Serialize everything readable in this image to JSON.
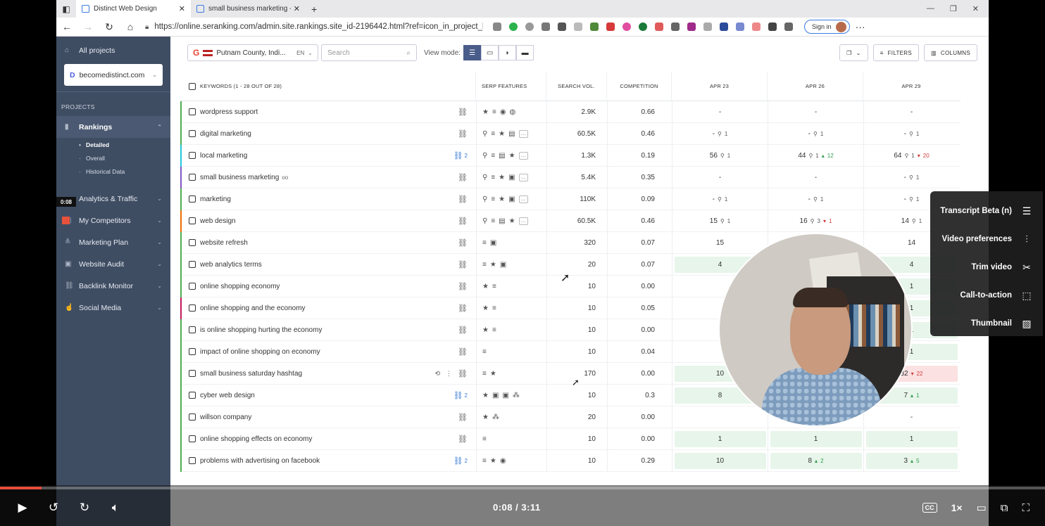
{
  "browser": {
    "tabs": [
      {
        "title": "Distinct Web Design"
      },
      {
        "title": "small business marketing - Apr..."
      }
    ],
    "url": "https://online.seranking.com/admin.site.rankings.site_id-2196442.html?ref=icon_in_project_list_...",
    "signin": "Sign in"
  },
  "sidebar": {
    "all_projects": "All projects",
    "project": "becomedistinct.com",
    "projects_head": "PROJECTS",
    "rankings": "Rankings",
    "sub": [
      "Detailed",
      "Overall",
      "Historical Data"
    ],
    "items": [
      "Analytics & Traffic",
      "My Competitors",
      "Marketing Plan",
      "Website Audit",
      "Backlink Monitor",
      "Social Media"
    ]
  },
  "toolbar": {
    "location": "Putnam County, Indi...",
    "lang": "EN",
    "search_placeholder": "Search",
    "view_mode": "View mode:",
    "filters": "FILTERS",
    "columns": "COLUMNS"
  },
  "table": {
    "headers": {
      "keywords": "KEYWORDS (1 - 28 OUT OF 28)",
      "serp": "SERP FEATURES",
      "vol": "SEARCH VOL.",
      "comp": "COMPETITION",
      "d1": "APR 23",
      "d2": "APR 26",
      "d3": "APR 29"
    },
    "rows": [
      {
        "kw": "wordpress support",
        "vol": "2.9K",
        "comp": "0.66",
        "d1": "-",
        "d2": "-",
        "d3": "-"
      },
      {
        "kw": "digital marketing",
        "vol": "60.5K",
        "comp": "0.46",
        "d1": "-",
        "d1p": "1",
        "d2": "-",
        "d2p": "1",
        "d3": "-",
        "d3p": "1"
      },
      {
        "kw": "local marketing",
        "links": "2",
        "vol": "1.3K",
        "comp": "0.19",
        "d1": "56",
        "d1p": "1",
        "d2": "44",
        "d2p": "1",
        "d2c": "12",
        "d3": "64",
        "d3p": "1",
        "d3c": "20"
      },
      {
        "kw": "small business marketing",
        "tag": "oo",
        "vol": "5.4K",
        "comp": "0.35",
        "d1": "-",
        "d2": "-",
        "d3": "-",
        "d3p": "1"
      },
      {
        "kw": "marketing",
        "vol": "110K",
        "comp": "0.09",
        "d1": "-",
        "d1p": "1",
        "d2": "-",
        "d2p": "1",
        "d3": "-",
        "d3p": "1"
      },
      {
        "kw": "web design",
        "vol": "60.5K",
        "comp": "0.46",
        "d1": "15",
        "d1p": "1",
        "d2": "16",
        "d2p": "3",
        "d2c": "1",
        "d3": "14",
        "d3p": "1"
      },
      {
        "kw": "website refresh",
        "vol": "320",
        "comp": "0.07",
        "d1": "15",
        "d2": "",
        "d3": "14"
      },
      {
        "kw": "web analytics terms",
        "vol": "20",
        "comp": "0.07",
        "d1": "4",
        "d2": "",
        "d3": "4"
      },
      {
        "kw": "online shopping economy",
        "vol": "10",
        "comp": "0.00",
        "d1": "",
        "d2": "",
        "d3": "1"
      },
      {
        "kw": "online shopping and the economy",
        "vol": "10",
        "comp": "0.05",
        "d1": "",
        "d2": "",
        "d3": "1"
      },
      {
        "kw": "is online shopping hurting the economy",
        "vol": "10",
        "comp": "0.00",
        "d1": "",
        "d2": "",
        "d3": "1"
      },
      {
        "kw": "impact of online shopping on economy",
        "vol": "10",
        "comp": "0.04",
        "d1": "",
        "d2": "",
        "d3": "1"
      },
      {
        "kw": "small business saturday hashtag",
        "vol": "170",
        "comp": "0.00",
        "d1": "10",
        "d2": "",
        "d3": "32",
        "d3c": "22"
      },
      {
        "kw": "cyber web design",
        "links": "2",
        "vol": "10",
        "comp": "0.3",
        "d1": "8",
        "d2": "",
        "d3": "7",
        "d3c": "1"
      },
      {
        "kw": "willson company",
        "vol": "20",
        "comp": "0.00",
        "d1": "",
        "d2": "",
        "d3": "-"
      },
      {
        "kw": "online shopping effects on economy",
        "vol": "10",
        "comp": "0.00",
        "d1": "1",
        "d2": "1",
        "d3": "1"
      },
      {
        "kw": "problems with advertising on facebook",
        "links": "2",
        "vol": "10",
        "comp": "0.29",
        "d1": "10",
        "d2": "8",
        "d2c": "2",
        "d3": "3",
        "d3c": "5"
      }
    ]
  },
  "video": {
    "time": "0:08 / 3:11",
    "speed": "1×",
    "cc": "CC",
    "badge": "0:08",
    "menu": [
      "Transcript Beta (n)",
      "Video preferences",
      "Trim video",
      "Call-to-action",
      "Thumbnail"
    ]
  },
  "colors": {
    "sidebar": "#3f4d63",
    "accent": "#4a5c8a",
    "progress": "#e74c3c"
  }
}
